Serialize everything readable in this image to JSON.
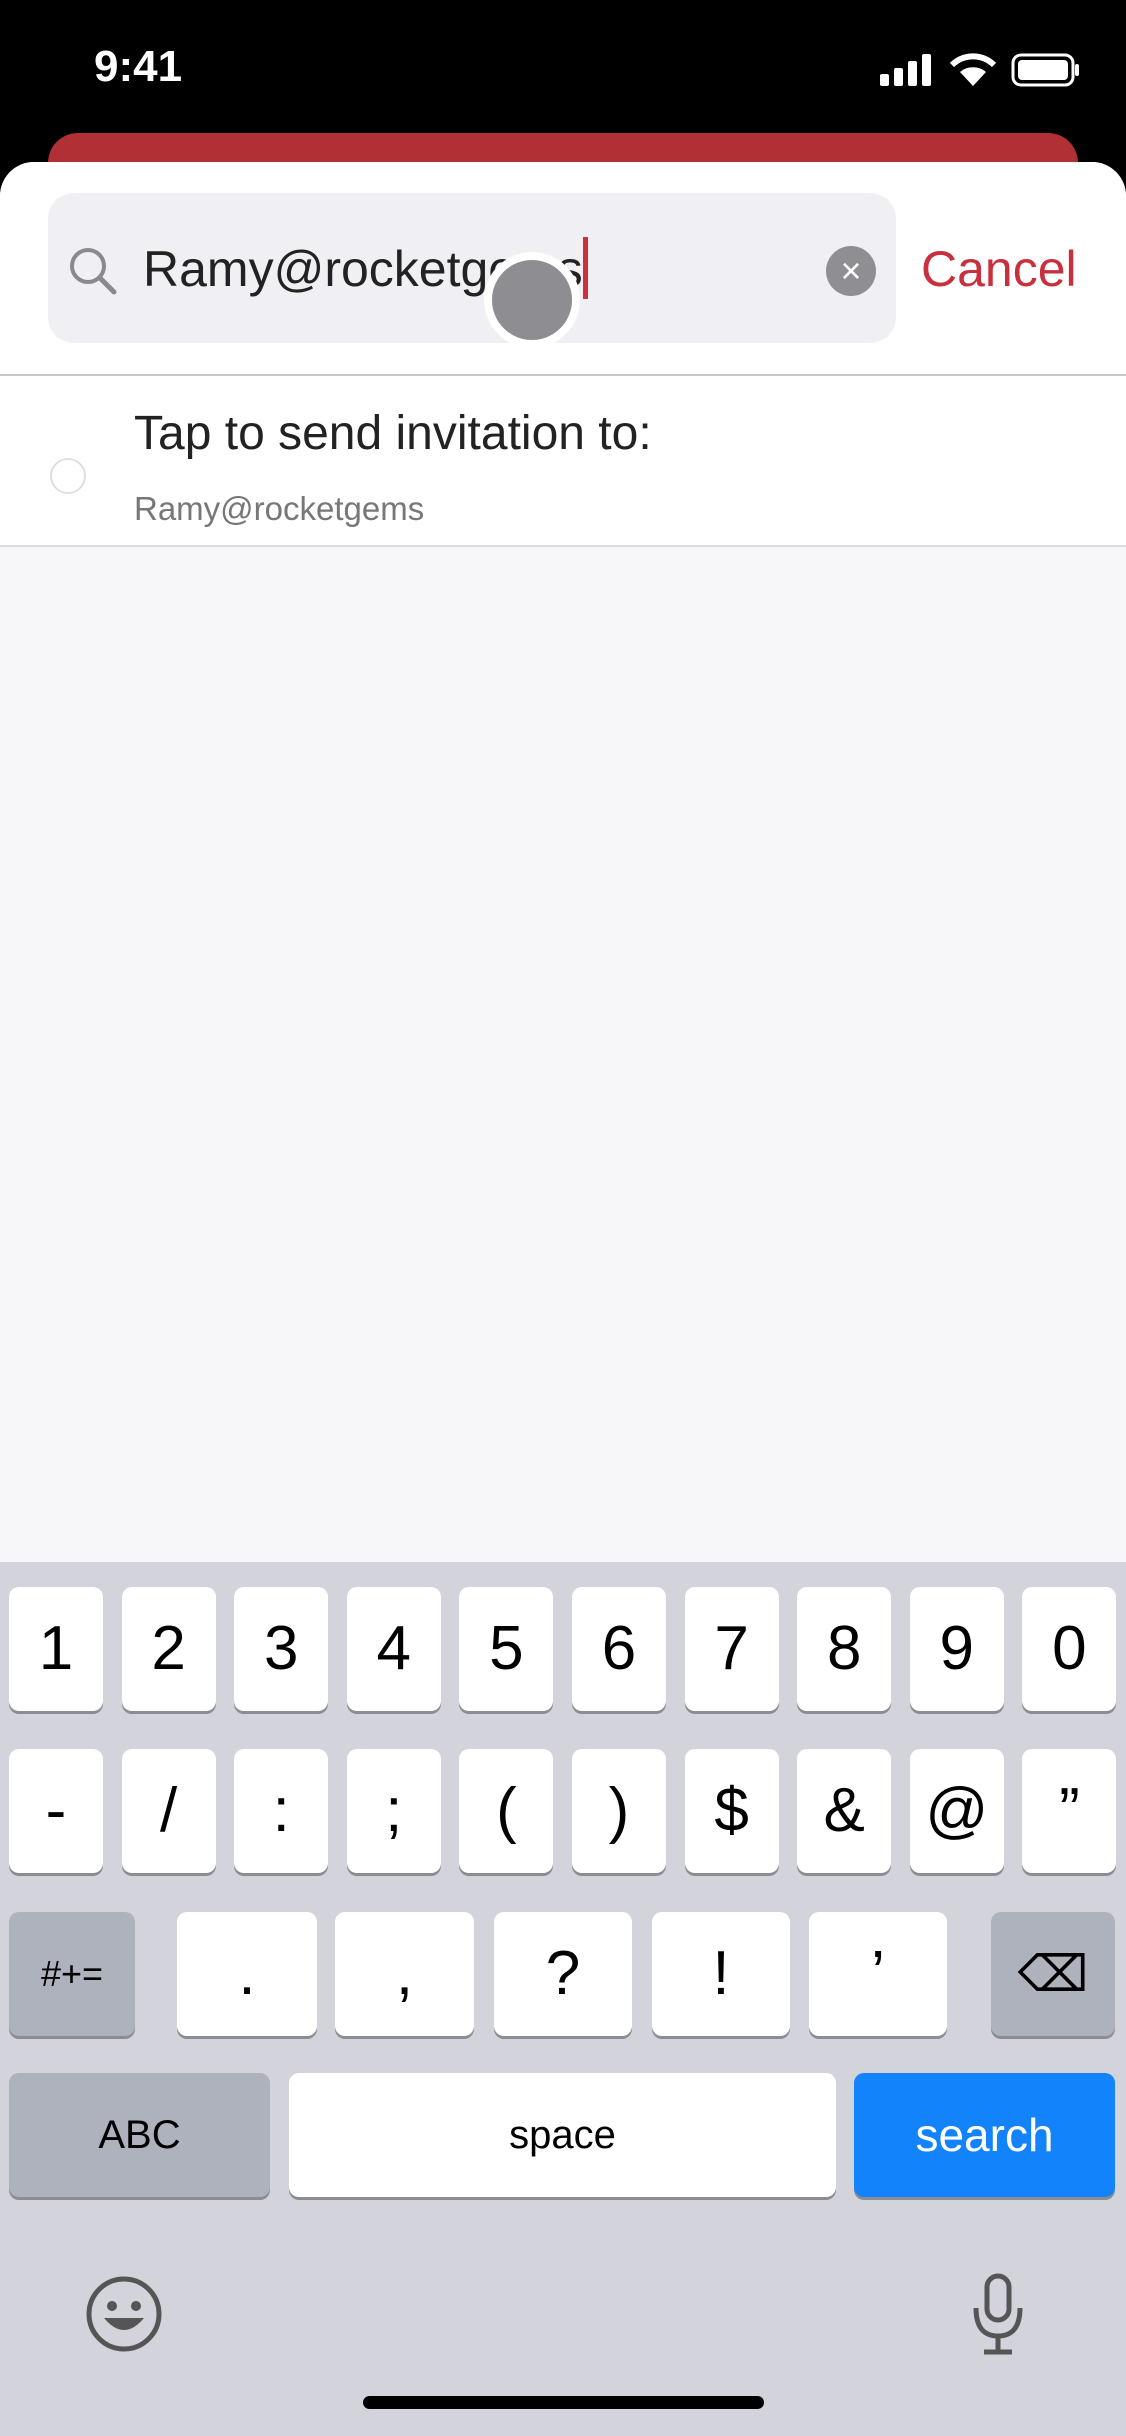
{
  "status": {
    "time": "9:41"
  },
  "search": {
    "value": "Ramy@rocketgems",
    "cancel": "Cancel",
    "clear": "×"
  },
  "invite": {
    "title": "Tap to send invitation to:",
    "email": "Ramy@rocketgems"
  },
  "keyboard": {
    "row1": [
      "1",
      "2",
      "3",
      "4",
      "5",
      "6",
      "7",
      "8",
      "9",
      "0"
    ],
    "row2": [
      "-",
      "/",
      ":",
      ";",
      "(",
      ")",
      "$",
      "&",
      "@",
      "”"
    ],
    "row3": [
      "#+=",
      ".",
      ",",
      "?",
      "!",
      "’"
    ],
    "backspace": "⌫",
    "abc": "ABC",
    "space": "space",
    "search": "search"
  },
  "colors": {
    "accent": "#c9303d",
    "header": "#b03035",
    "search_key": "#1283fb"
  }
}
